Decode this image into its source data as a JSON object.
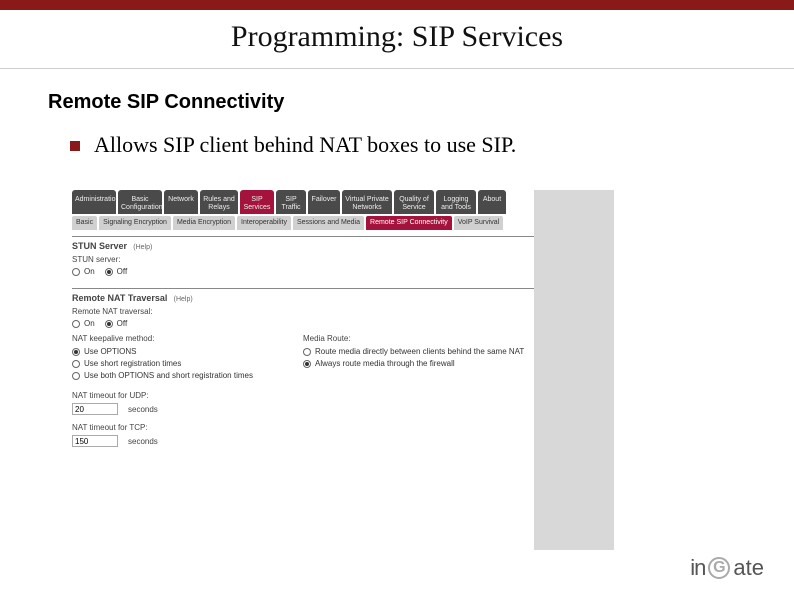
{
  "slide": {
    "title": "Programming: SIP Services",
    "subtitle": "Remote SIP Connectivity",
    "bullet": "Allows SIP client behind NAT boxes to use SIP."
  },
  "ui": {
    "main_tabs": [
      "Administration",
      "Basic Configuration",
      "Network",
      "Rules and Relays",
      "SIP Services",
      "SIP Traffic",
      "Failover",
      "Virtual Private Networks",
      "Quality of Service",
      "Logging and Tools",
      "About"
    ],
    "sub_tabs": [
      "Basic",
      "Signaling Encryption",
      "Media Encryption",
      "Interoperability",
      "Sessions and Media",
      "Remote SIP Connectivity",
      "VoIP Survival"
    ],
    "stun": {
      "header": "STUN Server",
      "help": "(Help)",
      "label": "STUN server:",
      "on": "On",
      "off": "Off"
    },
    "rnt": {
      "header": "Remote NAT Traversal",
      "help": "(Help)",
      "label": "Remote NAT traversal:",
      "on": "On",
      "off": "Off",
      "keepalive_hdr": "NAT keepalive method:",
      "mediaroute_hdr": "Media Route:",
      "opt1": "Use OPTIONS",
      "opt2": "Use short registration times",
      "opt3": "Use both OPTIONS and short registration times",
      "m1": "Route media directly between clients behind the same NAT",
      "m2": "Always route media through the firewall",
      "udp_label": "NAT timeout for UDP:",
      "udp_value": "20",
      "tcp_label": "NAT timeout for TCP:",
      "tcp_value": "150",
      "seconds": "seconds"
    }
  },
  "logo": {
    "left": "in",
    "right": "ate"
  }
}
